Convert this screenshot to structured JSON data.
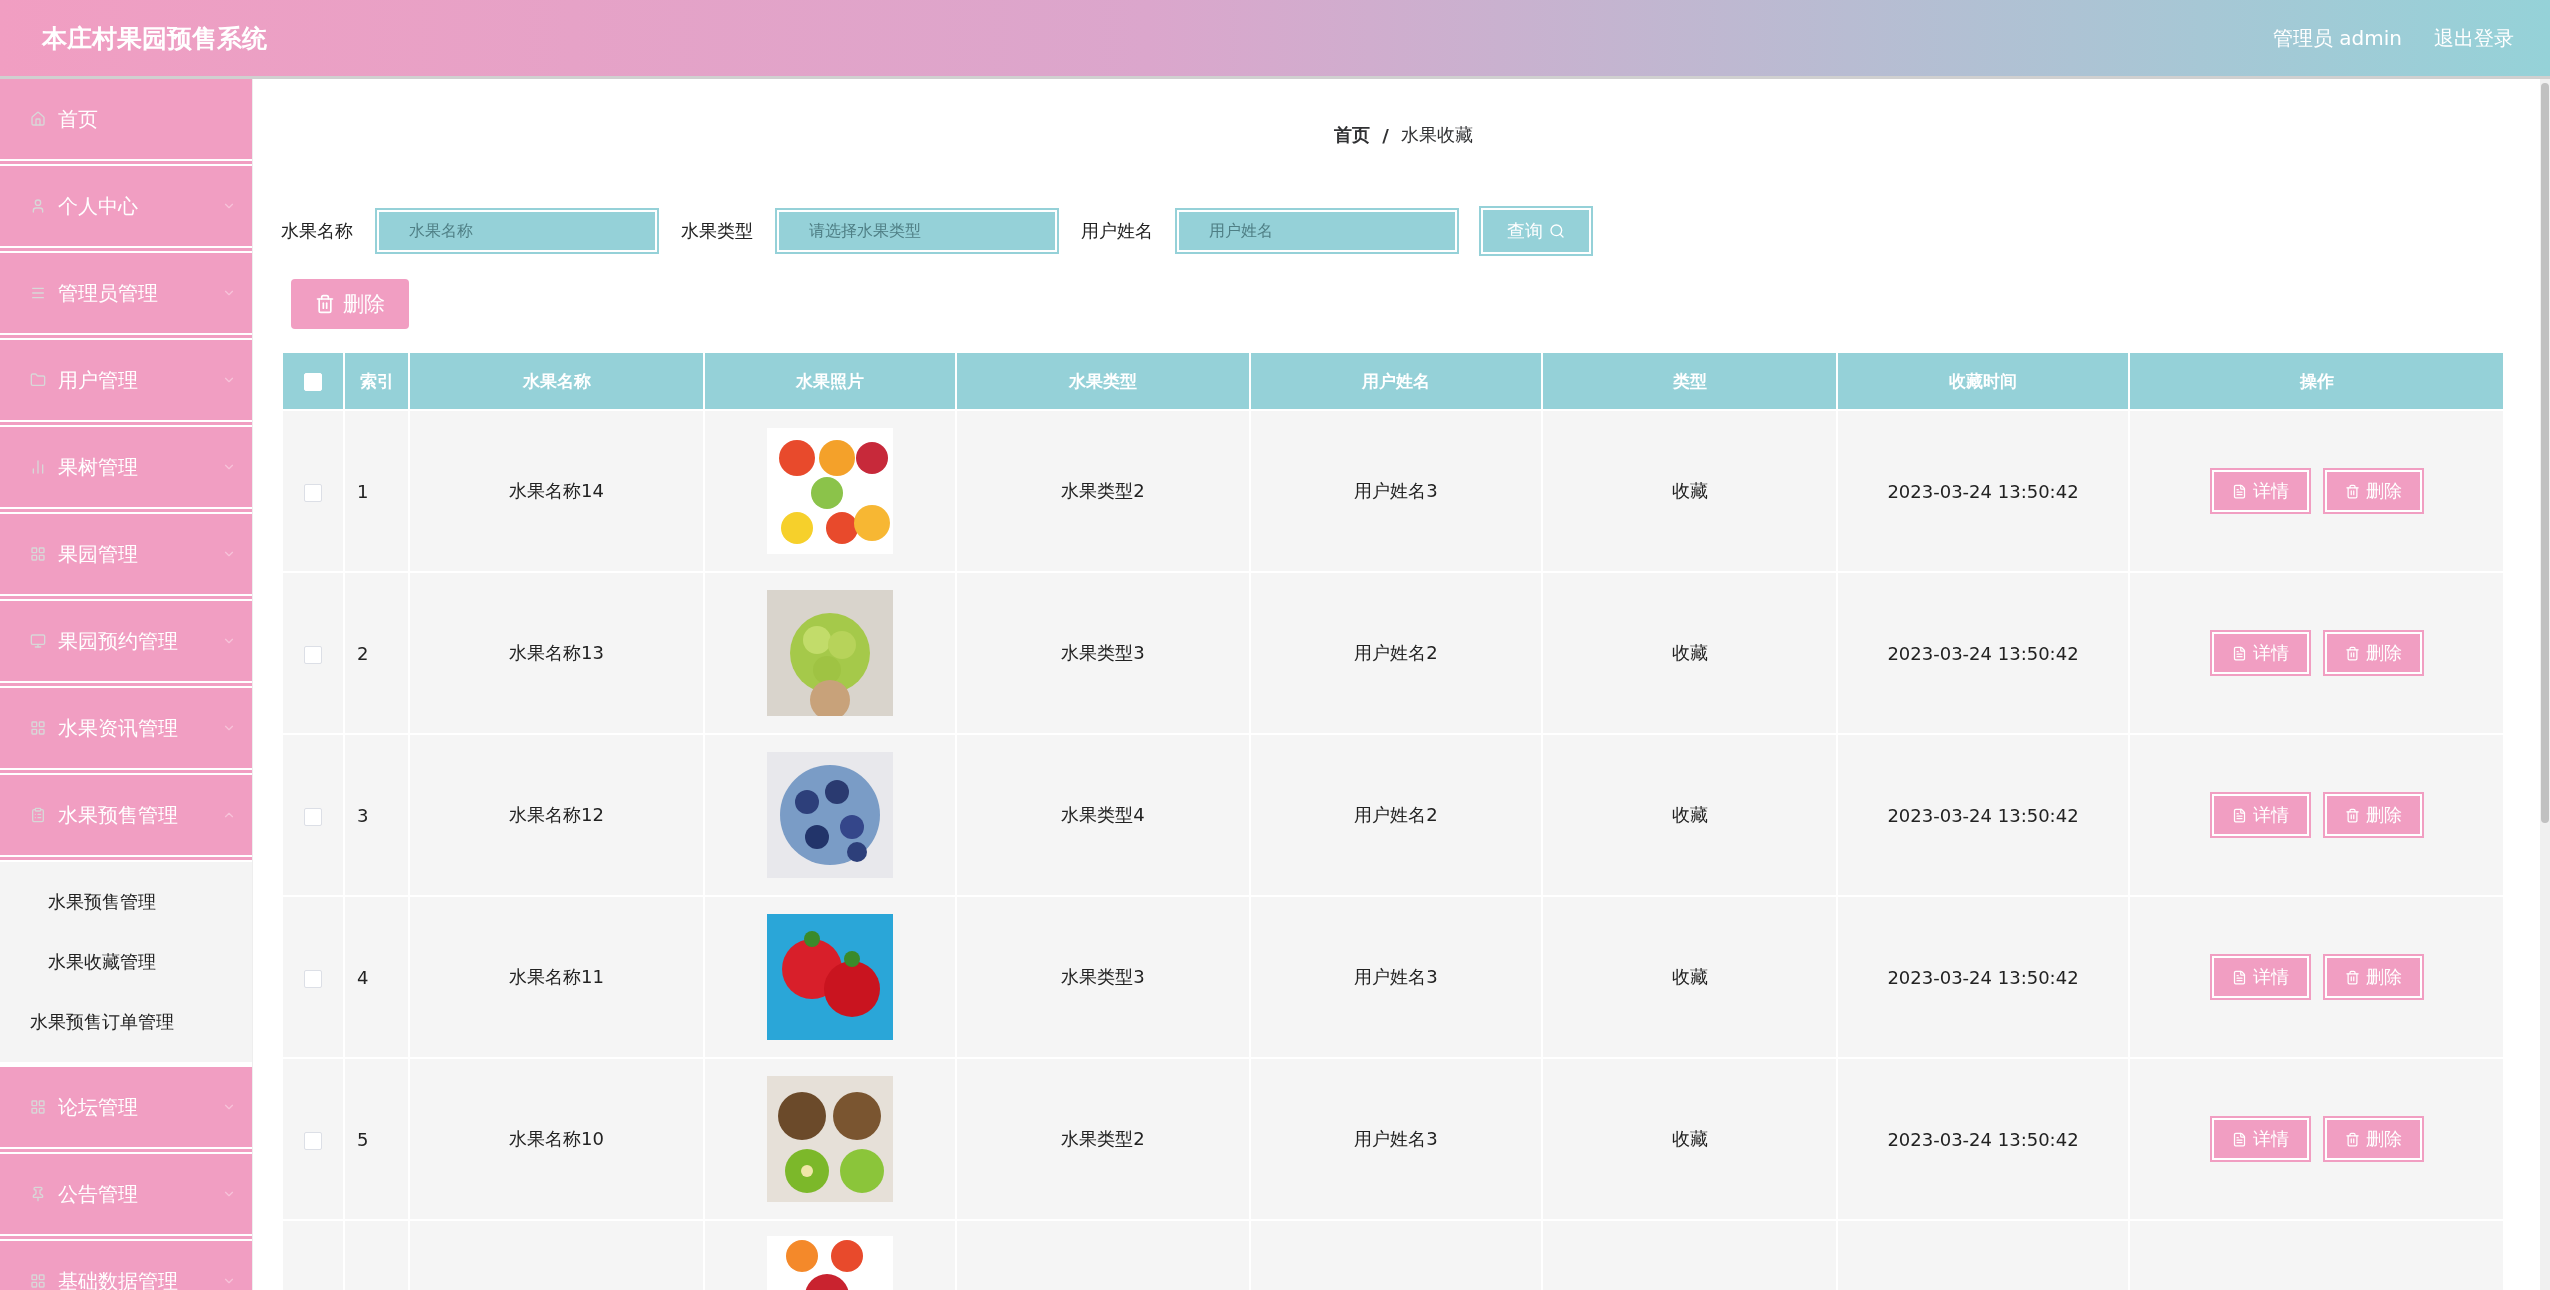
{
  "header": {
    "title": "本庄村果园预售系统",
    "user": "管理员 admin",
    "logout": "退出登录"
  },
  "sidebar": {
    "items": [
      {
        "label": "首页"
      },
      {
        "label": "个人中心",
        "expanded": false
      },
      {
        "label": "管理员管理",
        "expanded": false
      },
      {
        "label": "用户管理",
        "expanded": false
      },
      {
        "label": "果树管理",
        "expanded": false
      },
      {
        "label": "果园管理",
        "expanded": false
      },
      {
        "label": "果园预约管理",
        "expanded": false
      },
      {
        "label": "水果资讯管理",
        "expanded": false
      },
      {
        "label": "水果预售管理",
        "expanded": true,
        "children": [
          {
            "label": "水果预售管理",
            "kind": "nested"
          },
          {
            "label": "水果收藏管理",
            "kind": "nested"
          },
          {
            "label": "水果预售订单管理",
            "kind": "plain"
          }
        ]
      },
      {
        "label": "论坛管理",
        "expanded": false
      },
      {
        "label": "公告管理",
        "expanded": false
      },
      {
        "label": "基础数据管理",
        "expanded": false
      }
    ]
  },
  "breadcrumb": [
    "首页",
    "水果收藏"
  ],
  "breadcrumb_separator": "/",
  "search": {
    "fields": [
      {
        "label": "水果名称",
        "placeholder": "水果名称"
      },
      {
        "label": "水果类型",
        "placeholder": "请选择水果类型"
      },
      {
        "label": "用户姓名",
        "placeholder": "用户姓名"
      }
    ],
    "button": "查询"
  },
  "delete_button": "删除",
  "table": {
    "header_checked": false,
    "columns": [
      "索引",
      "水果名称",
      "水果照片",
      "水果类型",
      "用户姓名",
      "类型",
      "收藏时间",
      "操作"
    ],
    "rows": [
      {
        "checked": false,
        "index": "1",
        "name": "水果名称14",
        "type": "水果类型2",
        "user": "用户姓名3",
        "kind": "收藏",
        "time": "2023-03-24 13:50:42",
        "actions": [
          "详情",
          "删除"
        ]
      },
      {
        "checked": false,
        "index": "2",
        "name": "水果名称13",
        "type": "水果类型3",
        "user": "用户姓名2",
        "kind": "收藏",
        "time": "2023-03-24 13:50:42",
        "actions": [
          "详情",
          "删除"
        ]
      },
      {
        "checked": false,
        "index": "3",
        "name": "水果名称12",
        "type": "水果类型4",
        "user": "用户姓名2",
        "kind": "收藏",
        "time": "2023-03-24 13:50:42",
        "actions": [
          "详情",
          "删除"
        ]
      },
      {
        "checked": false,
        "index": "4",
        "name": "水果名称11",
        "type": "水果类型3",
        "user": "用户姓名3",
        "kind": "收藏",
        "time": "2023-03-24 13:50:42",
        "actions": [
          "详情",
          "删除"
        ]
      },
      {
        "checked": false,
        "index": "5",
        "name": "水果名称10",
        "type": "水果类型2",
        "user": "用户姓名3",
        "kind": "收藏",
        "time": "2023-03-24 13:50:42",
        "actions": [
          "详情",
          "删除"
        ]
      }
    ]
  }
}
